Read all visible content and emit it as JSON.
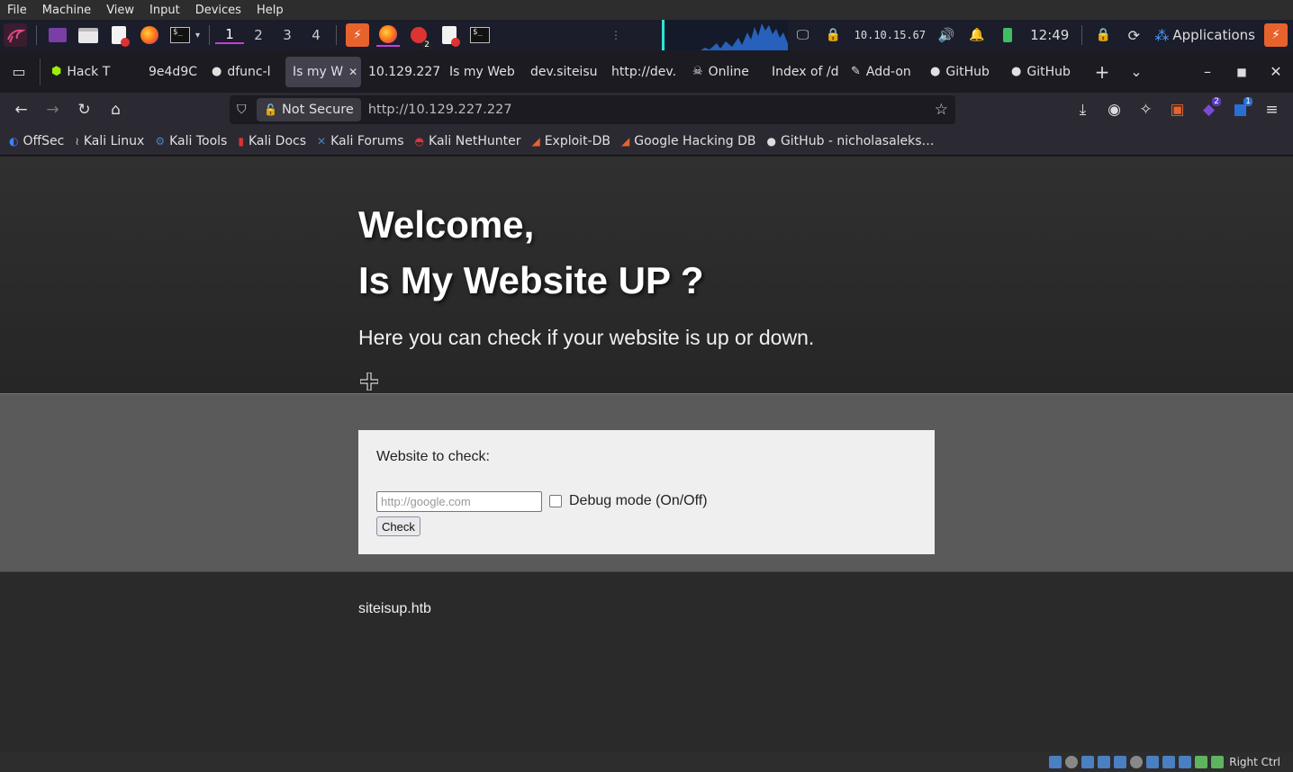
{
  "vbox_menu": [
    "File",
    "Machine",
    "View",
    "Input",
    "Devices",
    "Help"
  ],
  "panel": {
    "workspaces": [
      "1",
      "2",
      "3",
      "4"
    ],
    "active_workspace": "1",
    "ip": "10.10.15.67",
    "time": "12:49",
    "applications": "Applications",
    "badge_count": "2"
  },
  "tabs": [
    {
      "label": "Hack T",
      "icon": "htb-cube-icon"
    },
    {
      "label": "9e4d9C",
      "icon": ""
    },
    {
      "label": "dfunc-l",
      "icon": "github-icon"
    },
    {
      "label": "Is my W",
      "icon": "",
      "active": true
    },
    {
      "label": "10.129.227",
      "icon": ""
    },
    {
      "label": "Is my Web",
      "icon": ""
    },
    {
      "label": "dev.siteisu",
      "icon": ""
    },
    {
      "label": "http://dev.",
      "icon": ""
    },
    {
      "label": "Online",
      "icon": "skull-icon"
    },
    {
      "label": "Index of /d",
      "icon": ""
    },
    {
      "label": "Add-on",
      "icon": "puzzle-icon"
    },
    {
      "label": "GitHub",
      "icon": "github-icon"
    },
    {
      "label": "GitHub",
      "icon": "github-icon"
    }
  ],
  "navbar": {
    "security_label": "Not Secure",
    "url": "http://10.129.227.227",
    "ext_badge_1": "2",
    "ext_badge_2": "1"
  },
  "bookmarks": [
    {
      "label": "OffSec",
      "icon": "offsec-icon",
      "color": "#3b82f6"
    },
    {
      "label": "Kali Linux",
      "icon": "kali-dragon-icon",
      "color": "#cccccc"
    },
    {
      "label": "Kali Tools",
      "icon": "kali-tools-icon",
      "color": "#4a7fc1"
    },
    {
      "label": "Kali Docs",
      "icon": "kali-docs-icon",
      "color": "#d33"
    },
    {
      "label": "Kali Forums",
      "icon": "kali-forums-icon",
      "color": "#4a7fc1"
    },
    {
      "label": "Kali NetHunter",
      "icon": "nethunter-icon",
      "color": "#d33"
    },
    {
      "label": "Exploit-DB",
      "icon": "exploitdb-icon",
      "color": "#e8622c"
    },
    {
      "label": "Google Hacking DB",
      "icon": "ghdb-icon",
      "color": "#e8622c"
    },
    {
      "label": "GitHub - nicholasaleks…",
      "icon": "github-icon",
      "color": "#dddddd"
    }
  ],
  "page": {
    "heading_1": "Welcome,",
    "heading_2": "Is My Website UP ?",
    "subtitle": "Here you can check if your website is up or down.",
    "form": {
      "label": "Website to check:",
      "input_placeholder": "http://google.com",
      "input_value": "",
      "debug_label": "Debug mode (On/Off)",
      "debug_checked": false,
      "button_label": "Check"
    },
    "footer": "siteisup.htb"
  },
  "statusbar": {
    "host_key": "Right Ctrl"
  }
}
